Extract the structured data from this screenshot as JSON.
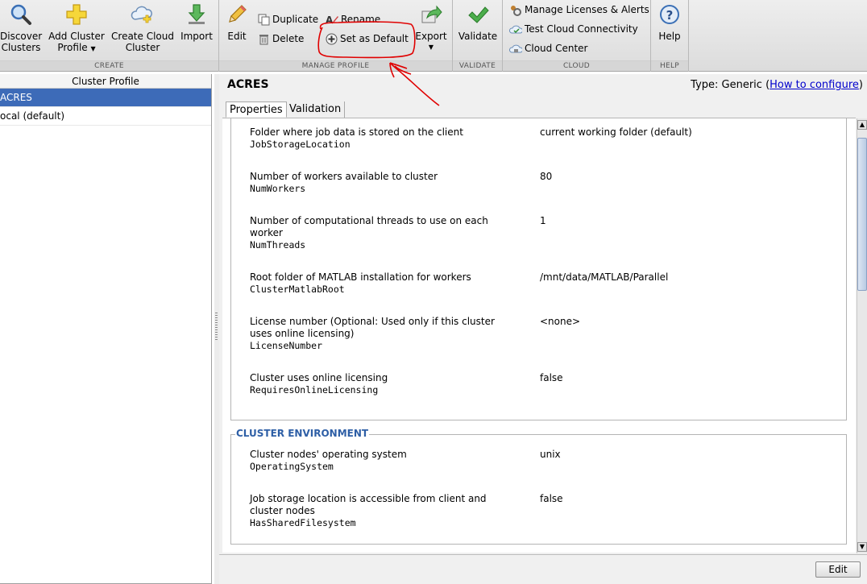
{
  "toolstrip": {
    "create": {
      "label": "CREATE",
      "discover_line1": "Discover",
      "discover_line2": "Clusters",
      "add_line1": "Add Cluster",
      "add_line2": "Profile",
      "cloud_line1": "Create Cloud",
      "cloud_line2": "Cluster",
      "import": "Import"
    },
    "manage": {
      "label": "MANAGE PROFILE",
      "edit": "Edit",
      "duplicate": "Duplicate",
      "delete": "Delete",
      "rename": "Rename",
      "set_default": "Set as Default",
      "export": "Export"
    },
    "validate": {
      "label": "VALIDATE",
      "validate": "Validate"
    },
    "cloud": {
      "label": "CLOUD",
      "manage_licenses": "Manage Licenses & Alerts",
      "test_connectivity": "Test Cloud Connectivity",
      "cloud_center": "Cloud Center"
    },
    "help": {
      "label": "HELP",
      "help": "Help"
    }
  },
  "left_panel": {
    "header": "Cluster Profile",
    "profiles": [
      "ACRES",
      "ocal (default)"
    ]
  },
  "right_panel": {
    "title": "ACRES",
    "type_prefix": "Type: Generic (",
    "type_link": "How to configure",
    "type_suffix": ")",
    "tabs": [
      "Properties",
      "Validation"
    ],
    "properties": [
      {
        "label": "Folder where job data is stored on the client",
        "name": "JobStorageLocation",
        "value": "current working folder (default)"
      },
      {
        "label": "Number of workers available to cluster",
        "name": "NumWorkers",
        "value": "80"
      },
      {
        "label": "Number of computational threads to use on each worker",
        "name": "NumThreads",
        "value": "1"
      },
      {
        "label": "Root folder of MATLAB installation for workers",
        "name": "ClusterMatlabRoot",
        "value": "/mnt/data/MATLAB/Parallel"
      },
      {
        "label": "License number (Optional: Used only if this cluster uses online licensing)",
        "name": "LicenseNumber",
        "value": "<none>"
      },
      {
        "label": "Cluster uses online licensing",
        "name": "RequiresOnlineLicensing",
        "value": "false"
      }
    ],
    "cluster_environment": {
      "heading": "CLUSTER ENVIRONMENT",
      "properties": [
        {
          "label": "Cluster nodes' operating system",
          "name": "OperatingSystem",
          "value": "unix"
        },
        {
          "label": "Job storage location is accessible from client and cluster nodes",
          "name": "HasSharedFilesystem",
          "value": "false"
        }
      ]
    },
    "edit_button": "Edit"
  },
  "colors": {
    "selected_row": "#3d6bb8",
    "section_heading": "#2e5fa6",
    "link": "#0000cc",
    "annotation": "#e00000"
  }
}
